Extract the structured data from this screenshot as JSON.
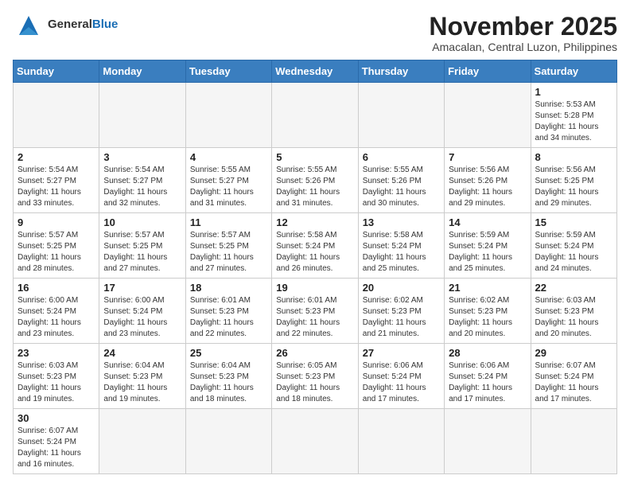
{
  "header": {
    "logo_line1": "General",
    "logo_line2": "Blue",
    "month_title": "November 2025",
    "subtitle": "Amacalan, Central Luzon, Philippines"
  },
  "weekdays": [
    "Sunday",
    "Monday",
    "Tuesday",
    "Wednesday",
    "Thursday",
    "Friday",
    "Saturday"
  ],
  "weeks": [
    [
      {
        "day": "",
        "info": ""
      },
      {
        "day": "",
        "info": ""
      },
      {
        "day": "",
        "info": ""
      },
      {
        "day": "",
        "info": ""
      },
      {
        "day": "",
        "info": ""
      },
      {
        "day": "",
        "info": ""
      },
      {
        "day": "1",
        "info": "Sunrise: 5:53 AM\nSunset: 5:28 PM\nDaylight: 11 hours and 34 minutes."
      }
    ],
    [
      {
        "day": "2",
        "info": "Sunrise: 5:54 AM\nSunset: 5:27 PM\nDaylight: 11 hours and 33 minutes."
      },
      {
        "day": "3",
        "info": "Sunrise: 5:54 AM\nSunset: 5:27 PM\nDaylight: 11 hours and 32 minutes."
      },
      {
        "day": "4",
        "info": "Sunrise: 5:55 AM\nSunset: 5:27 PM\nDaylight: 11 hours and 31 minutes."
      },
      {
        "day": "5",
        "info": "Sunrise: 5:55 AM\nSunset: 5:26 PM\nDaylight: 11 hours and 31 minutes."
      },
      {
        "day": "6",
        "info": "Sunrise: 5:55 AM\nSunset: 5:26 PM\nDaylight: 11 hours and 30 minutes."
      },
      {
        "day": "7",
        "info": "Sunrise: 5:56 AM\nSunset: 5:26 PM\nDaylight: 11 hours and 29 minutes."
      },
      {
        "day": "8",
        "info": "Sunrise: 5:56 AM\nSunset: 5:25 PM\nDaylight: 11 hours and 29 minutes."
      }
    ],
    [
      {
        "day": "9",
        "info": "Sunrise: 5:57 AM\nSunset: 5:25 PM\nDaylight: 11 hours and 28 minutes."
      },
      {
        "day": "10",
        "info": "Sunrise: 5:57 AM\nSunset: 5:25 PM\nDaylight: 11 hours and 27 minutes."
      },
      {
        "day": "11",
        "info": "Sunrise: 5:57 AM\nSunset: 5:25 PM\nDaylight: 11 hours and 27 minutes."
      },
      {
        "day": "12",
        "info": "Sunrise: 5:58 AM\nSunset: 5:24 PM\nDaylight: 11 hours and 26 minutes."
      },
      {
        "day": "13",
        "info": "Sunrise: 5:58 AM\nSunset: 5:24 PM\nDaylight: 11 hours and 25 minutes."
      },
      {
        "day": "14",
        "info": "Sunrise: 5:59 AM\nSunset: 5:24 PM\nDaylight: 11 hours and 25 minutes."
      },
      {
        "day": "15",
        "info": "Sunrise: 5:59 AM\nSunset: 5:24 PM\nDaylight: 11 hours and 24 minutes."
      }
    ],
    [
      {
        "day": "16",
        "info": "Sunrise: 6:00 AM\nSunset: 5:24 PM\nDaylight: 11 hours and 23 minutes."
      },
      {
        "day": "17",
        "info": "Sunrise: 6:00 AM\nSunset: 5:24 PM\nDaylight: 11 hours and 23 minutes."
      },
      {
        "day": "18",
        "info": "Sunrise: 6:01 AM\nSunset: 5:23 PM\nDaylight: 11 hours and 22 minutes."
      },
      {
        "day": "19",
        "info": "Sunrise: 6:01 AM\nSunset: 5:23 PM\nDaylight: 11 hours and 22 minutes."
      },
      {
        "day": "20",
        "info": "Sunrise: 6:02 AM\nSunset: 5:23 PM\nDaylight: 11 hours and 21 minutes."
      },
      {
        "day": "21",
        "info": "Sunrise: 6:02 AM\nSunset: 5:23 PM\nDaylight: 11 hours and 20 minutes."
      },
      {
        "day": "22",
        "info": "Sunrise: 6:03 AM\nSunset: 5:23 PM\nDaylight: 11 hours and 20 minutes."
      }
    ],
    [
      {
        "day": "23",
        "info": "Sunrise: 6:03 AM\nSunset: 5:23 PM\nDaylight: 11 hours and 19 minutes."
      },
      {
        "day": "24",
        "info": "Sunrise: 6:04 AM\nSunset: 5:23 PM\nDaylight: 11 hours and 19 minutes."
      },
      {
        "day": "25",
        "info": "Sunrise: 6:04 AM\nSunset: 5:23 PM\nDaylight: 11 hours and 18 minutes."
      },
      {
        "day": "26",
        "info": "Sunrise: 6:05 AM\nSunset: 5:23 PM\nDaylight: 11 hours and 18 minutes."
      },
      {
        "day": "27",
        "info": "Sunrise: 6:06 AM\nSunset: 5:24 PM\nDaylight: 11 hours and 17 minutes."
      },
      {
        "day": "28",
        "info": "Sunrise: 6:06 AM\nSunset: 5:24 PM\nDaylight: 11 hours and 17 minutes."
      },
      {
        "day": "29",
        "info": "Sunrise: 6:07 AM\nSunset: 5:24 PM\nDaylight: 11 hours and 17 minutes."
      }
    ],
    [
      {
        "day": "30",
        "info": "Sunrise: 6:07 AM\nSunset: 5:24 PM\nDaylight: 11 hours and 16 minutes."
      },
      {
        "day": "",
        "info": ""
      },
      {
        "day": "",
        "info": ""
      },
      {
        "day": "",
        "info": ""
      },
      {
        "day": "",
        "info": ""
      },
      {
        "day": "",
        "info": ""
      },
      {
        "day": "",
        "info": ""
      }
    ]
  ]
}
